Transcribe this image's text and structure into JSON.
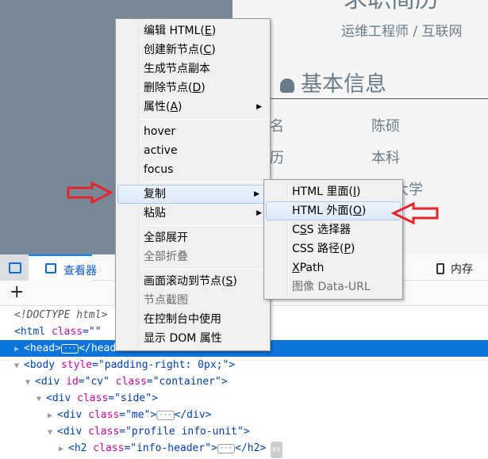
{
  "page": {
    "title": "求职简历",
    "subtitle": "运维工程师 / 互联网",
    "section_title": "基本信息",
    "section_icon": "user-icon",
    "rows": [
      {
        "label": "姓名",
        "value": "陈硕"
      },
      {
        "label": "学历",
        "value": "本科"
      },
      {
        "label": "",
        "value": "浙江大学"
      }
    ]
  },
  "devtools": {
    "tabs": [
      {
        "label": "查看器",
        "icon": "inspector-icon"
      },
      {
        "label": "内存",
        "icon": "memory-icon"
      }
    ],
    "picker_icon": "element-picker-icon",
    "add_icon": "plus-icon",
    "tree": [
      {
        "text": "<!DOCTYPE html>"
      },
      {
        "tag": "<html",
        "attr": " class",
        "val": "=\"\"",
        "rest": " l"
      },
      {
        "open": "<head>",
        "close": "</head>"
      },
      {
        "tag": "<body",
        "attr": " style",
        "val": "=\"padding-right: 0px;\"",
        "rest": ">"
      },
      {
        "tag": "<div",
        "attr": " id",
        "val": "=\"cv\"",
        "attr2": " class",
        "val2": "=\"container\"",
        "rest": ">"
      },
      {
        "tag": "<div",
        "attr": " class",
        "val": "=\"side\"",
        "rest": ">"
      },
      {
        "tag": "<div",
        "attr": " class",
        "val": "=\"me\"",
        "rest": ">",
        "close": "</div>"
      },
      {
        "tag": "<div",
        "attr": " class",
        "val": "=\"profile info-unit\"",
        "rest": ">"
      },
      {
        "tag": "<h2",
        "attr": " class",
        "val": "=\"info-header\"",
        "rest": ">",
        "close": "</h2>",
        "badge": "ev"
      }
    ]
  },
  "context_menu": {
    "items": [
      {
        "label": "编辑 HTML(",
        "key": "E",
        "end": ")"
      },
      {
        "label": "创建新节点(",
        "key": "C",
        "end": ")"
      },
      {
        "label": "生成节点副本"
      },
      {
        "label": "删除节点(",
        "key": "D",
        "end": ")"
      },
      {
        "label": "属性(",
        "key": "A",
        "end": ")"
      },
      {
        "label": "hover"
      },
      {
        "label": "active"
      },
      {
        "label": "focus"
      },
      {
        "label": "复制"
      },
      {
        "label": "粘贴"
      },
      {
        "label": "全部展开"
      },
      {
        "label": "全部折叠"
      },
      {
        "label": "画面滚动到节点(",
        "key": "S",
        "end": ")"
      },
      {
        "label": "节点截图"
      },
      {
        "label": "在控制台中使用"
      },
      {
        "label": "显示 DOM 属性"
      }
    ]
  },
  "copy_submenu": {
    "items": [
      {
        "label": "HTML 里面(",
        "key": "I",
        "end": ")"
      },
      {
        "label": "HTML 外面(",
        "key": "O",
        "end": ")"
      },
      {
        "pre": "C",
        "key": "S",
        "label": "S 选择器"
      },
      {
        "label": "CSS 路径(",
        "key": "P",
        "end": ")"
      },
      {
        "key": "X",
        "label": "Path"
      },
      {
        "label": "图像 Data-URL"
      }
    ]
  },
  "annotation_color": "#e8232a",
  "highlight_color": "#0a74da"
}
